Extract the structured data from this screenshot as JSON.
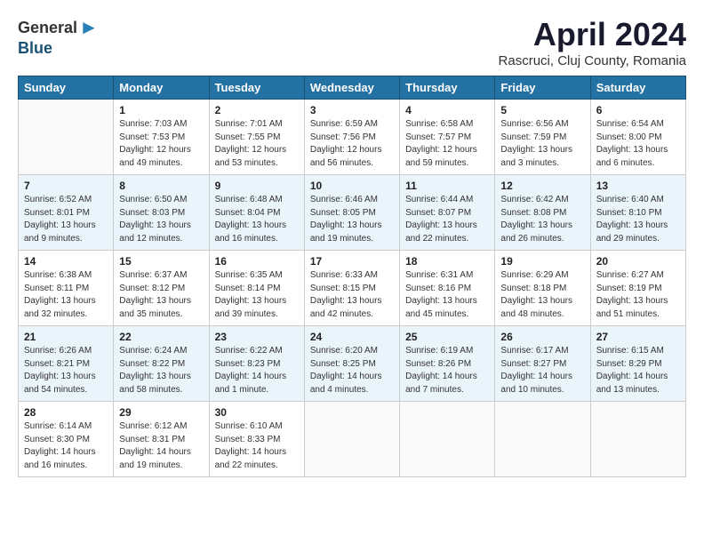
{
  "header": {
    "logo_general": "General",
    "logo_blue": "Blue",
    "month_title": "April 2024",
    "location": "Rascruci, Cluj County, Romania"
  },
  "days_of_week": [
    "Sunday",
    "Monday",
    "Tuesday",
    "Wednesday",
    "Thursday",
    "Friday",
    "Saturday"
  ],
  "weeks": [
    [
      {
        "day": "",
        "info": ""
      },
      {
        "day": "1",
        "info": "Sunrise: 7:03 AM\nSunset: 7:53 PM\nDaylight: 12 hours\nand 49 minutes."
      },
      {
        "day": "2",
        "info": "Sunrise: 7:01 AM\nSunset: 7:55 PM\nDaylight: 12 hours\nand 53 minutes."
      },
      {
        "day": "3",
        "info": "Sunrise: 6:59 AM\nSunset: 7:56 PM\nDaylight: 12 hours\nand 56 minutes."
      },
      {
        "day": "4",
        "info": "Sunrise: 6:58 AM\nSunset: 7:57 PM\nDaylight: 12 hours\nand 59 minutes."
      },
      {
        "day": "5",
        "info": "Sunrise: 6:56 AM\nSunset: 7:59 PM\nDaylight: 13 hours\nand 3 minutes."
      },
      {
        "day": "6",
        "info": "Sunrise: 6:54 AM\nSunset: 8:00 PM\nDaylight: 13 hours\nand 6 minutes."
      }
    ],
    [
      {
        "day": "7",
        "info": "Sunrise: 6:52 AM\nSunset: 8:01 PM\nDaylight: 13 hours\nand 9 minutes."
      },
      {
        "day": "8",
        "info": "Sunrise: 6:50 AM\nSunset: 8:03 PM\nDaylight: 13 hours\nand 12 minutes."
      },
      {
        "day": "9",
        "info": "Sunrise: 6:48 AM\nSunset: 8:04 PM\nDaylight: 13 hours\nand 16 minutes."
      },
      {
        "day": "10",
        "info": "Sunrise: 6:46 AM\nSunset: 8:05 PM\nDaylight: 13 hours\nand 19 minutes."
      },
      {
        "day": "11",
        "info": "Sunrise: 6:44 AM\nSunset: 8:07 PM\nDaylight: 13 hours\nand 22 minutes."
      },
      {
        "day": "12",
        "info": "Sunrise: 6:42 AM\nSunset: 8:08 PM\nDaylight: 13 hours\nand 26 minutes."
      },
      {
        "day": "13",
        "info": "Sunrise: 6:40 AM\nSunset: 8:10 PM\nDaylight: 13 hours\nand 29 minutes."
      }
    ],
    [
      {
        "day": "14",
        "info": "Sunrise: 6:38 AM\nSunset: 8:11 PM\nDaylight: 13 hours\nand 32 minutes."
      },
      {
        "day": "15",
        "info": "Sunrise: 6:37 AM\nSunset: 8:12 PM\nDaylight: 13 hours\nand 35 minutes."
      },
      {
        "day": "16",
        "info": "Sunrise: 6:35 AM\nSunset: 8:14 PM\nDaylight: 13 hours\nand 39 minutes."
      },
      {
        "day": "17",
        "info": "Sunrise: 6:33 AM\nSunset: 8:15 PM\nDaylight: 13 hours\nand 42 minutes."
      },
      {
        "day": "18",
        "info": "Sunrise: 6:31 AM\nSunset: 8:16 PM\nDaylight: 13 hours\nand 45 minutes."
      },
      {
        "day": "19",
        "info": "Sunrise: 6:29 AM\nSunset: 8:18 PM\nDaylight: 13 hours\nand 48 minutes."
      },
      {
        "day": "20",
        "info": "Sunrise: 6:27 AM\nSunset: 8:19 PM\nDaylight: 13 hours\nand 51 minutes."
      }
    ],
    [
      {
        "day": "21",
        "info": "Sunrise: 6:26 AM\nSunset: 8:21 PM\nDaylight: 13 hours\nand 54 minutes."
      },
      {
        "day": "22",
        "info": "Sunrise: 6:24 AM\nSunset: 8:22 PM\nDaylight: 13 hours\nand 58 minutes."
      },
      {
        "day": "23",
        "info": "Sunrise: 6:22 AM\nSunset: 8:23 PM\nDaylight: 14 hours\nand 1 minute."
      },
      {
        "day": "24",
        "info": "Sunrise: 6:20 AM\nSunset: 8:25 PM\nDaylight: 14 hours\nand 4 minutes."
      },
      {
        "day": "25",
        "info": "Sunrise: 6:19 AM\nSunset: 8:26 PM\nDaylight: 14 hours\nand 7 minutes."
      },
      {
        "day": "26",
        "info": "Sunrise: 6:17 AM\nSunset: 8:27 PM\nDaylight: 14 hours\nand 10 minutes."
      },
      {
        "day": "27",
        "info": "Sunrise: 6:15 AM\nSunset: 8:29 PM\nDaylight: 14 hours\nand 13 minutes."
      }
    ],
    [
      {
        "day": "28",
        "info": "Sunrise: 6:14 AM\nSunset: 8:30 PM\nDaylight: 14 hours\nand 16 minutes."
      },
      {
        "day": "29",
        "info": "Sunrise: 6:12 AM\nSunset: 8:31 PM\nDaylight: 14 hours\nand 19 minutes."
      },
      {
        "day": "30",
        "info": "Sunrise: 6:10 AM\nSunset: 8:33 PM\nDaylight: 14 hours\nand 22 minutes."
      },
      {
        "day": "",
        "info": ""
      },
      {
        "day": "",
        "info": ""
      },
      {
        "day": "",
        "info": ""
      },
      {
        "day": "",
        "info": ""
      }
    ]
  ]
}
